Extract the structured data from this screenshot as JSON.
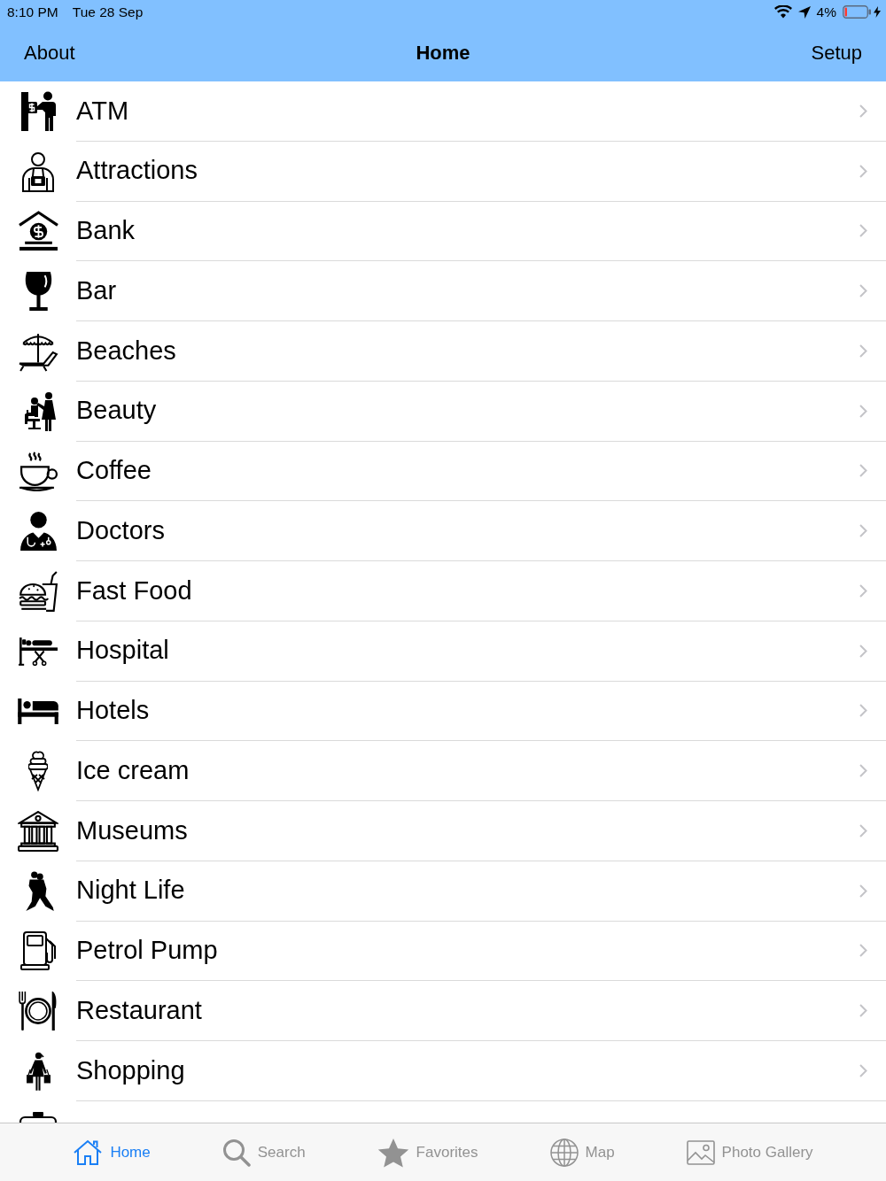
{
  "status_bar": {
    "time": "8:10 PM",
    "date": "Tue 28 Sep",
    "battery_percent": "4%"
  },
  "nav_bar": {
    "left_button": "About",
    "title": "Home",
    "right_button": "Setup"
  },
  "list": {
    "items": [
      {
        "label": "ATM"
      },
      {
        "label": "Attractions"
      },
      {
        "label": "Bank"
      },
      {
        "label": "Bar"
      },
      {
        "label": "Beaches"
      },
      {
        "label": "Beauty"
      },
      {
        "label": "Coffee"
      },
      {
        "label": "Doctors"
      },
      {
        "label": "Fast Food"
      },
      {
        "label": "Hospital"
      },
      {
        "label": "Hotels"
      },
      {
        "label": "Ice cream"
      },
      {
        "label": "Museums"
      },
      {
        "label": "Night Life"
      },
      {
        "label": "Petrol Pump"
      },
      {
        "label": "Restaurant"
      },
      {
        "label": "Shopping"
      }
    ],
    "partially_hidden_row": true
  },
  "tab_bar": {
    "tabs": [
      {
        "label": "Home",
        "selected": true
      },
      {
        "label": "Search",
        "selected": false
      },
      {
        "label": "Favorites",
        "selected": false
      },
      {
        "label": "Map",
        "selected": false
      },
      {
        "label": "Photo Gallery",
        "selected": false
      }
    ]
  }
}
